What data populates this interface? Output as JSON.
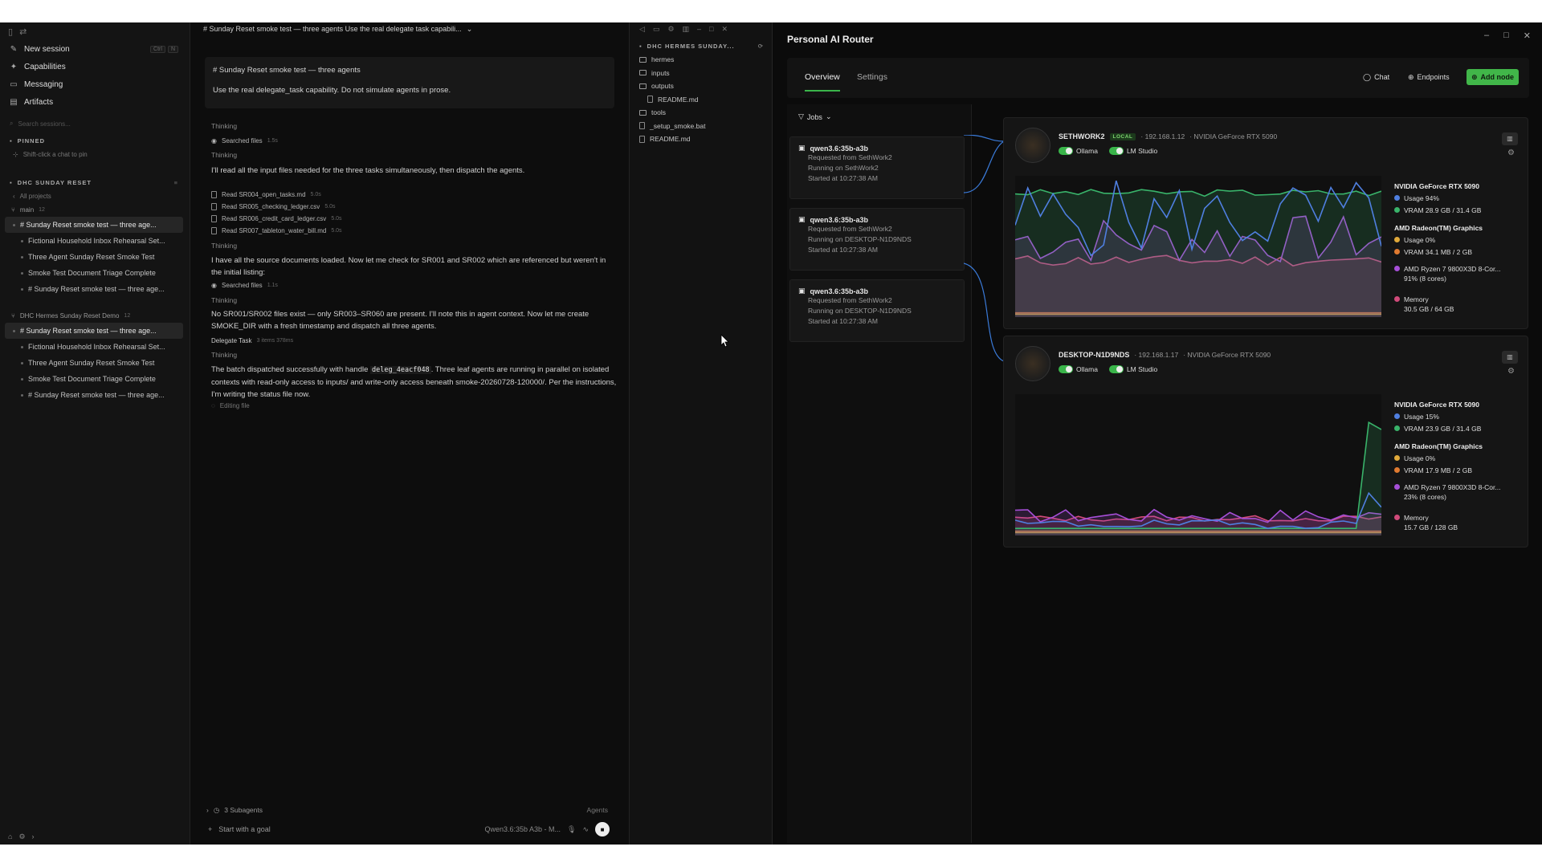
{
  "sidebar": {
    "nav": [
      {
        "label": "New session",
        "icon": "new-session-icon"
      },
      {
        "label": "Capabilities",
        "icon": "capabilities-icon"
      },
      {
        "label": "Messaging",
        "icon": "messaging-icon"
      },
      {
        "label": "Artifacts",
        "icon": "artifacts-icon"
      }
    ],
    "new_session_shortcut": [
      "Ctrl",
      "N"
    ],
    "search_placeholder": "Search sessions...",
    "pinned_header": "PINNED",
    "pinned_hint": "Shift-click a chat to pin",
    "group_header": "DHC SUNDAY RESET",
    "all_projects": "All projects",
    "branch_main": {
      "label": "main",
      "count": "12"
    },
    "sessions_a": [
      "# Sunday Reset smoke test — three age...",
      "Fictional Household Inbox Rehearsal Set...",
      "Three Agent Sunday Reset Smoke Test",
      "Smoke Test Document Triage Complete",
      "# Sunday Reset smoke test — three age..."
    ],
    "branch_demo": {
      "label": "DHC Hermes Sunday Reset Demo",
      "count": "12"
    },
    "sessions_b": [
      "# Sunday Reset smoke test — three age...",
      "Fictional Household Inbox Rehearsal Set...",
      "Three Agent Sunday Reset Smoke Test",
      "Smoke Test Document Triage Complete",
      "# Sunday Reset smoke test — three age..."
    ]
  },
  "chat": {
    "title": "# Sunday Reset smoke test — three agents Use the real delegate task capabili...",
    "prompt_line1": "# Sunday Reset smoke test — three agents",
    "prompt_line2": "Use the real delegate_task capability. Do not simulate agents in prose.",
    "thinking": "Thinking",
    "searched_files": "Searched files",
    "searched_time_1": "1.5s",
    "searched_time_2": "1.1s",
    "msg1": "I'll read all the input files needed for the three tasks simultaneously, then dispatch the agents.",
    "reads": [
      {
        "label": "Read SR004_open_tasks.md",
        "t": "5.0s"
      },
      {
        "label": "Read SR005_checking_ledger.csv",
        "t": "5.0s"
      },
      {
        "label": "Read SR006_credit_card_ledger.csv",
        "t": "5.0s"
      },
      {
        "label": "Read SR007_tableton_water_bill.md",
        "t": "5.0s"
      }
    ],
    "msg2": "I have all the source documents loaded. Now let me check for SR001 and SR002 which are referenced but weren't in the initial listing:",
    "msg3": "No SR001/SR002 files exist — only SR003–SR060 are present. I'll note this in agent context. Now let me create SMOKE_DIR with a fresh timestamp and dispatch all three agents.",
    "delegate_task": "Delegate Task",
    "delegate_meta": "3 items  378ms",
    "msg4_a": "The batch dispatched successfully with handle",
    "handle": "deleg_4eacf048",
    "msg4_b": ". Three leaf agents are running in parallel on isolated contexts with read-only access to inputs/ and write-only access beneath smoke-20260728-120000/. Per the instructions, I'm writing the status file now.",
    "editing": "Editing file",
    "subagents": "3 Subagents",
    "agents_label": "Agents",
    "composer_placeholder": "Start with a goal",
    "model": "Qwen3.6:35b A3b - M..."
  },
  "tree": {
    "header": "DHC HERMES SUNDAY...",
    "items": [
      {
        "label": "hermes",
        "type": "folder",
        "indent": 0
      },
      {
        "label": "inputs",
        "type": "folder",
        "indent": 0
      },
      {
        "label": "outputs",
        "type": "folder",
        "indent": 0
      },
      {
        "label": "README.md",
        "type": "file",
        "indent": 1
      },
      {
        "label": "tools",
        "type": "folder",
        "indent": 0
      },
      {
        "label": "_setup_smoke.bat",
        "type": "file",
        "indent": 0
      },
      {
        "label": "README.md",
        "type": "file",
        "indent": 0
      }
    ]
  },
  "router": {
    "title": "Personal AI Router",
    "tabs": [
      "Overview",
      "Settings"
    ],
    "chat_btn": "Chat",
    "endpoints_btn": "Endpoints",
    "add_node_btn": "Add node",
    "jobs_label": "Jobs",
    "jobs": [
      {
        "model": "qwen3.6:35b-a3b",
        "requested": "Requested from SethWork2",
        "running": "Running on SethWork2",
        "started": "Started at 10:27:38 AM"
      },
      {
        "model": "qwen3.6:35b-a3b",
        "requested": "Requested from SethWork2",
        "running": "Running on DESKTOP-N1D9NDS",
        "started": "Started at 10:27:38 AM"
      },
      {
        "model": "qwen3.6:35b-a3b",
        "requested": "Requested from SethWork2",
        "running": "Running on DESKTOP-N1D9NDS",
        "started": "Started at 10:27:38 AM"
      }
    ],
    "nodes": [
      {
        "name": "SETHWORK2",
        "badge": "LOCAL",
        "ip": "· 192.168.1.12",
        "gpu": "· NVIDIA GeForce RTX 5090",
        "ollama": "Ollama",
        "lmstudio": "LM Studio",
        "gpu1_name": "NVIDIA GeForce RTX 5090",
        "gpu1_usage": "Usage  94%",
        "gpu1_vram": "VRAM  28.9 GB / 31.4 GB",
        "gpu2_name": "AMD Radeon(TM) Graphics",
        "gpu2_usage": "Usage  0%",
        "gpu2_vram": "VRAM  34.1 MB / 2 GB",
        "cpu_name": "AMD Ryzen 7 9800X3D 8-Cor...",
        "cpu_usage": "91% (8 cores)",
        "memory_label": "Memory",
        "memory_value": "30.5 GB / 64 GB"
      },
      {
        "name": "DESKTOP-N1D9NDS",
        "badge": "",
        "ip": "· 192.168.1.17",
        "gpu": "· NVIDIA GeForce RTX 5090",
        "ollama": "Ollama",
        "lmstudio": "LM Studio",
        "gpu1_name": "NVIDIA GeForce RTX 5090",
        "gpu1_usage": "Usage  15%",
        "gpu1_vram": "VRAM  23.9 GB / 31.4 GB",
        "gpu2_name": "AMD Radeon(TM) Graphics",
        "gpu2_usage": "Usage  0%",
        "gpu2_vram": "VRAM  17.9 MB / 2 GB",
        "cpu_name": "AMD Ryzen 7 9800X3D 8-Cor...",
        "cpu_usage": "23% (8 cores)",
        "memory_label": "Memory",
        "memory_value": "15.7 GB / 128 GB"
      }
    ]
  },
  "colors": {
    "accent_green": "#41b649",
    "series_gpu": "#4f7fe0",
    "series_vram": "#39b36a",
    "series_amd": "#e0a93a",
    "series_amd_vram": "#e07a30",
    "series_cpu": "#a64fd8",
    "series_mem": "#d04a7a"
  }
}
